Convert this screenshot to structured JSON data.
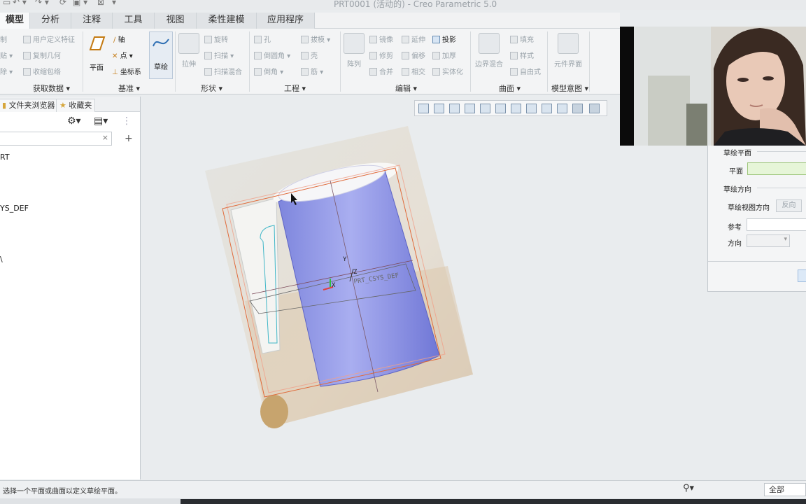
{
  "window": {
    "title": "PRT0001 (活动的) - Creo Parametric 5.0"
  },
  "tabs": [
    {
      "label": "模型",
      "active": true
    },
    {
      "label": "分析"
    },
    {
      "label": "注释"
    },
    {
      "label": "工具"
    },
    {
      "label": "视图"
    },
    {
      "label": "柔性建模"
    },
    {
      "label": "应用程序"
    }
  ],
  "ribbon": {
    "getdata": {
      "label": "获取数据",
      "items": [
        "制",
        "用户定义特征",
        "贴",
        "复制几何",
        "除",
        "收缩包络"
      ]
    },
    "datum": {
      "label": "基准",
      "plane": "平面",
      "axis": "轴",
      "point": "点",
      "csys": "坐标系",
      "sketch": "草绘"
    },
    "shapes": {
      "label": "形状",
      "extrude": "拉伸",
      "revolve": "旋转",
      "sweep": "扫描",
      "sweepblend": "扫描混合"
    },
    "engineering": {
      "label": "工程",
      "hole": "孔",
      "round": "倒圆角",
      "chamfer": "倒角",
      "draft": "拔模",
      "shell": "壳",
      "rib": "筋"
    },
    "editing": {
      "label": "编辑",
      "pattern": "阵列",
      "mirror": "镜像",
      "extend": "延伸",
      "project": "投影",
      "trim": "修剪",
      "offset": "偏移",
      "thicken": "加厚",
      "merge": "合并",
      "intersect": "相交",
      "solidify": "实体化"
    },
    "surfaces": {
      "label": "曲面",
      "boundary": "边界混合",
      "fill": "填充",
      "style": "样式",
      "freestyle": "自由式"
    },
    "intent": {
      "label": "模型意图",
      "component_interface": "元件界面"
    }
  },
  "navigator": {
    "tabs": [
      "文件夹浏览器",
      "收藏夹"
    ],
    "tree": [
      "RT",
      "YS_DEF",
      "\\"
    ]
  },
  "graphics": {
    "csys_label": "PRT_CSYS_DEF",
    "axes": [
      "Y",
      "Z",
      "X"
    ]
  },
  "dialog": {
    "sketch_plane_header": "草绘平面",
    "plane_label": "平面",
    "orientation_header": "草绘方向",
    "view_direction_label": "草绘视图方向",
    "flip_button": "反向",
    "reference_label": "参考",
    "direction_label": "方向"
  },
  "status": {
    "message": "选择一个平面或曲面以定义草绘平面。",
    "filter": "全部"
  },
  "colors": {
    "model_blue": "#8f95e6",
    "datum_orange": "#e06a3a",
    "accent": "#2f6fb3"
  }
}
